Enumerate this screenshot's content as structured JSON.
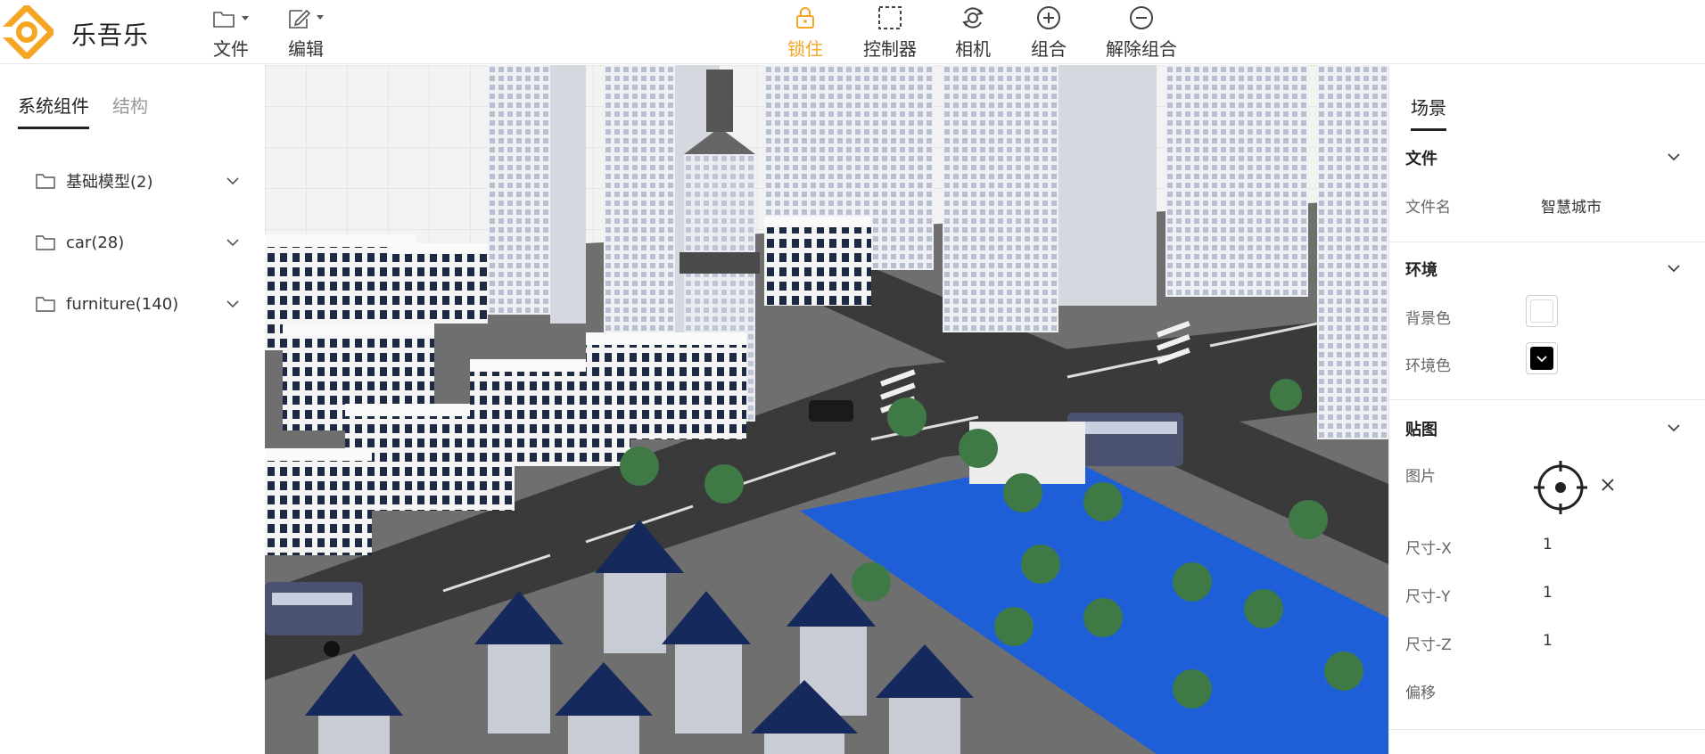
{
  "app": {
    "brand": "乐吾乐",
    "accent": "#f5a623"
  },
  "menus": [
    {
      "label": "文件",
      "icon": "folder-icon"
    },
    {
      "label": "编辑",
      "icon": "edit-icon"
    }
  ],
  "toolbar": [
    {
      "label": "锁住",
      "icon": "lock-icon",
      "active": true
    },
    {
      "label": "控制器",
      "icon": "controller-icon"
    },
    {
      "label": "相机",
      "icon": "camera-icon"
    },
    {
      "label": "组合",
      "icon": "plus-circle-icon"
    },
    {
      "label": "解除组合",
      "icon": "minus-circle-icon"
    }
  ],
  "left": {
    "tabs": [
      {
        "label": "系统组件",
        "active": true
      },
      {
        "label": "结构"
      }
    ],
    "folders": [
      {
        "label": "基础模型(2)"
      },
      {
        "label": "car(28)"
      },
      {
        "label": "furniture(140)"
      }
    ]
  },
  "right": {
    "tab": "场景",
    "file": {
      "title": "文件",
      "name_label": "文件名",
      "name_value": "智慧城市"
    },
    "env": {
      "title": "环境",
      "bg_label": "背景色",
      "bg_color": "#ffffff",
      "ambient_label": "环境色",
      "ambient_color": "#000000"
    },
    "texture": {
      "title": "贴图",
      "image_label": "图片",
      "size_x_label": "尺寸-X",
      "size_x": "1",
      "size_y_label": "尺寸-Y",
      "size_y": "1",
      "size_z_label": "尺寸-Z",
      "size_z": "1",
      "offset_label": "偏移"
    }
  }
}
